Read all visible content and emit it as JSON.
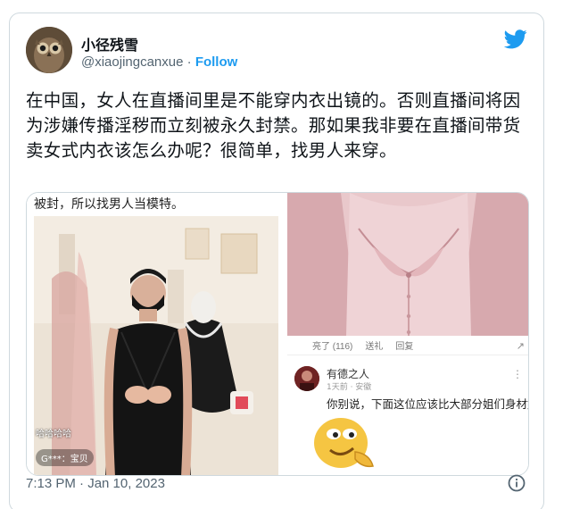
{
  "tweet": {
    "display_name": "小径残雪",
    "handle": "@xiaojingcanxue",
    "separator": " · ",
    "follow_label": "Follow",
    "text": "在中国，女人在直播间里是不能穿内衣出镜的。否则直播间将因为涉嫌传播淫秽而立刻被永久封禁。那如果我非要在直播间带货卖女式内衣该怎么办呢？很简单，找男人来穿。",
    "timestamp": "7:13 PM · Jan 10, 2023"
  },
  "media": {
    "left_caption": "被封，所以找男人当模特。",
    "live_chat": "哈哈哈哈",
    "live_user": "G***：宝贝",
    "action_bar": {
      "likes": "亮了 (116)",
      "gift": "送礼",
      "reply": "回复"
    },
    "comment": {
      "author": "有德之人",
      "meta": "1天前 · 安徽",
      "text": "你别说，下面这位应该比大部分姐们身材好"
    }
  },
  "icons": {
    "brand": "twitter-bird-icon",
    "info": "info-icon"
  },
  "colors": {
    "accent": "#1d9bf0",
    "text_primary": "#0f1419",
    "text_secondary": "#536471",
    "border": "#cfd9de"
  }
}
